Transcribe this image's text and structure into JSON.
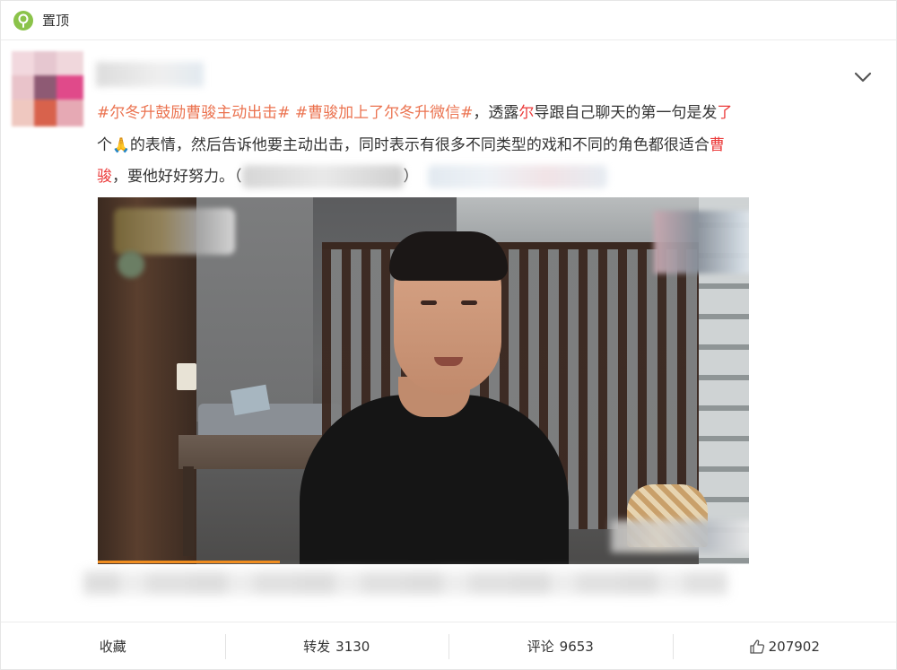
{
  "header": {
    "pin_label": "置顶",
    "pin_icon": "location-pin-icon",
    "accent": "#8bc34a"
  },
  "post": {
    "tag1": "#尔冬升鼓励曹骏主动出击#",
    "tag2": "#曹骏加上了尔冬升微信#",
    "t1": "，透露",
    "h1": "尔",
    "t2": "导跟自己聊天的第一句是发",
    "h2": "了",
    "t3": "个",
    "emoji": "🙏",
    "t4": "的表情，然后告诉他要主动出击，同时表示有很多不同类型的戏和不同的角色都很适合",
    "h3": "曹",
    "h4": "骏",
    "t5": "，要他好好努力。（",
    "t6": "）",
    "menu_icon": "chevron-down-icon"
  },
  "video": {
    "progress": 0.28
  },
  "actions": {
    "favorite_label": "收藏",
    "repost_label": "转发",
    "repost_count": "3130",
    "comment_label": "评论",
    "comment_count": "9653",
    "like_count": "207902",
    "like_icon": "thumbs-up-icon"
  },
  "colors": {
    "hashtag": "#eb7350",
    "highlight": "#eb3b3b",
    "progress": "#f08b1b"
  }
}
